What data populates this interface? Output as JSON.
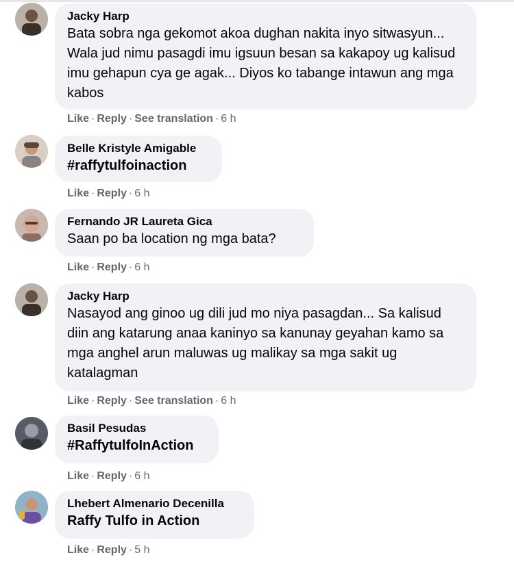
{
  "labels": {
    "like": "Like",
    "reply": "Reply",
    "see_translation": "See translation",
    "dot": "·"
  },
  "comments": [
    {
      "author": "Jacky Harp",
      "text": "Bata sobra nga gekomot akoa dughan nakita inyo sitwasyun... Wala jud nimu pasagdi imu igsuun besan sa kakapoy ug kalisud imu gehapun cya ge agak... Diyos ko tabange intawun ang mga kabos",
      "time": "6 h"
    },
    {
      "author": "Belle Kristyle Amigable",
      "text": "#raffytulfoinaction",
      "time": "6 h"
    },
    {
      "author": "Fernando JR Laureta Gica",
      "text": "Saan po ba location ng mga bata?",
      "time": "6 h"
    },
    {
      "author": "Jacky Harp",
      "text": "Nasayod ang ginoo ug dili jud mo niya pasagdan... Sa kalisud diin ang katarung anaa kaninyo sa kanunay geyahan kamo sa mga anghel arun maluwas ug malikay sa mga sakit ug katalagman",
      "time": "6 h"
    },
    {
      "author": "Basil Pesudas",
      "text": "#RaffytulfoInAction",
      "time": "6 h"
    },
    {
      "author": "Lhebert Almenario Decenilla",
      "text": "Raffy Tulfo in Action",
      "time": "5 h"
    }
  ],
  "colors": {
    "bubble": "#f0f2f5",
    "meta": "#65676b",
    "text": "#050505"
  }
}
